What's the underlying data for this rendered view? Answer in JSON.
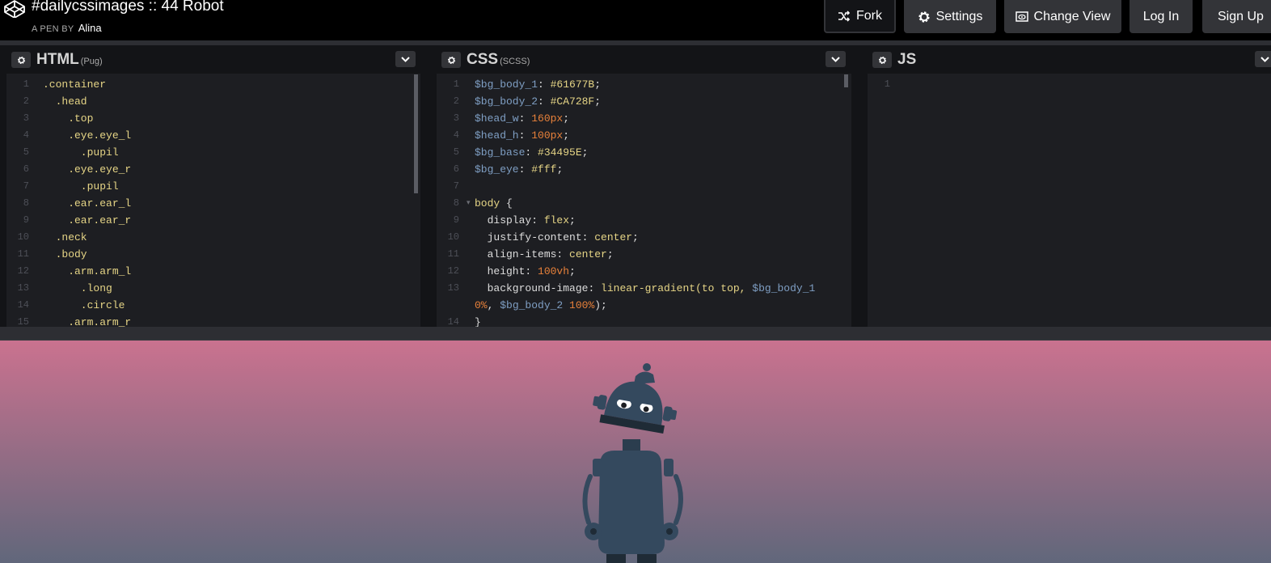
{
  "header": {
    "title": "#dailycssimages :: 44 Robot",
    "byline_prefix": "A PEN BY",
    "author": "Alina",
    "buttons": {
      "fork": "Fork",
      "settings": "Settings",
      "change_view": "Change View",
      "login": "Log In",
      "signup": "Sign Up"
    }
  },
  "editors": {
    "html": {
      "title": "HTML",
      "sub": "(Pug)",
      "lines": [
        {
          "n": "1",
          "t": ".container"
        },
        {
          "n": "2",
          "t": "  .head"
        },
        {
          "n": "3",
          "t": "    .top"
        },
        {
          "n": "4",
          "t": "    .eye.eye_l"
        },
        {
          "n": "5",
          "t": "      .pupil"
        },
        {
          "n": "6",
          "t": "    .eye.eye_r"
        },
        {
          "n": "7",
          "t": "      .pupil"
        },
        {
          "n": "8",
          "t": "    .ear.ear_l"
        },
        {
          "n": "9",
          "t": "    .ear.ear_r"
        },
        {
          "n": "10",
          "t": "  .neck"
        },
        {
          "n": "11",
          "t": "  .body"
        },
        {
          "n": "12",
          "t": "    .arm.arm_l"
        },
        {
          "n": "13",
          "t": "      .long"
        },
        {
          "n": "14",
          "t": "      .circle"
        },
        {
          "n": "15",
          "t": "    .arm.arm_r"
        }
      ]
    },
    "css": {
      "title": "CSS",
      "sub": "(SCSS)",
      "lines": [
        {
          "n": "1",
          "v": "$bg_body_1",
          "p": ": ",
          "s": "#61677B",
          "e": ";"
        },
        {
          "n": "2",
          "v": "$bg_body_2",
          "p": ": ",
          "s": "#CA728F",
          "e": ";"
        },
        {
          "n": "3",
          "v": "$head_w",
          "p": ": ",
          "num": "160px",
          "e": ";"
        },
        {
          "n": "4",
          "v": "$head_h",
          "p": ": ",
          "num": "100px",
          "e": ";"
        },
        {
          "n": "5",
          "v": "$bg_base",
          "p": ": ",
          "s": "#34495E",
          "e": ";"
        },
        {
          "n": "6",
          "v": "$bg_eye",
          "p": ": ",
          "s": "#fff",
          "e": ";"
        },
        {
          "n": "7"
        },
        {
          "n": "8",
          "sel": "body",
          "e": " {",
          "fold": true
        },
        {
          "n": "9",
          "prop": "  display",
          "p": ": ",
          "s": "flex",
          "e": ";"
        },
        {
          "n": "10",
          "prop": "  justify-content",
          "p": ": ",
          "s": "center",
          "e": ";"
        },
        {
          "n": "11",
          "prop": "  align-items",
          "p": ": ",
          "s": "center",
          "e": ";"
        },
        {
          "n": "12",
          "prop": "  height",
          "p": ": ",
          "num": "100vh",
          "e": ";"
        },
        {
          "n": "13",
          "prop": "  background-image",
          "p": ": ",
          "s": "linear-gradient(to top, ",
          "v2": "$bg_body_1"
        },
        {
          "n": "",
          "num": "0%",
          "p": ", ",
          "v2": "$bg_body_2",
          "num2": " 100%",
          "e": ");"
        },
        {
          "n": "14",
          "e": "}"
        }
      ]
    },
    "js": {
      "title": "JS",
      "lines": [
        {
          "n": "1",
          "t": ""
        }
      ]
    }
  },
  "preview": {
    "gradient_top": "#CA728F",
    "gradient_bottom": "#61677B",
    "robot_color": "#34495E"
  }
}
